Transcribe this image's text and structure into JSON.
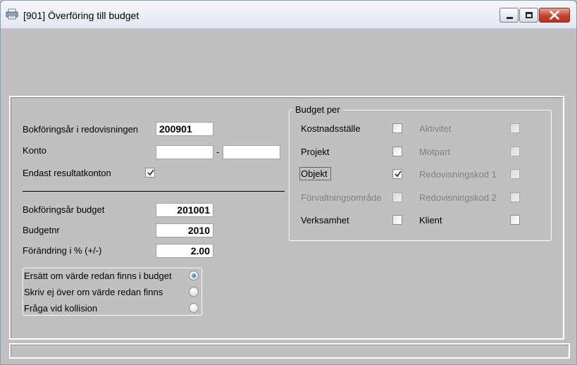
{
  "window": {
    "title": "[901]  Överföring till budget"
  },
  "form": {
    "bokforingsar_label": "Bokföringsår i redovisningen",
    "bokforingsar_value": "200901",
    "konto_label": "Konto",
    "konto_from": "",
    "konto_separator": "-",
    "konto_to": "",
    "endast_label": "Endast resultatkonton",
    "endast_checked": true,
    "budget_year_label": "Bokföringsår budget",
    "budget_year_value": "201001",
    "budgetnr_label": "Budgetnr",
    "budgetnr_value": "2010",
    "forandring_label": "Förändring i % (+/-)",
    "forandring_value": "2.00"
  },
  "budget_per": {
    "title": "Budget per",
    "left": [
      {
        "label": "Kostnadsställe",
        "checked": false,
        "enabled": true
      },
      {
        "label": "Projekt",
        "checked": false,
        "enabled": true
      },
      {
        "label": "Objekt",
        "checked": true,
        "enabled": true
      },
      {
        "label": "Förvaltningsområde",
        "checked": false,
        "enabled": false
      },
      {
        "label": "Verksamhet",
        "checked": false,
        "enabled": true
      }
    ],
    "right": [
      {
        "label": "Aktivitet",
        "checked": false,
        "enabled": false
      },
      {
        "label": "Motpart",
        "checked": false,
        "enabled": false
      },
      {
        "label": "Redovisningskod 1",
        "checked": false,
        "enabled": false
      },
      {
        "label": "Redovisningskod 2",
        "checked": false,
        "enabled": false
      },
      {
        "label": "Klient",
        "checked": false,
        "enabled": true
      }
    ]
  },
  "options": [
    {
      "label": "Ersätt om värde redan finns i budget",
      "selected": true
    },
    {
      "label": "Skriv ej över om värde redan finns",
      "selected": false
    },
    {
      "label": "Fråga vid kollision",
      "selected": false
    }
  ]
}
